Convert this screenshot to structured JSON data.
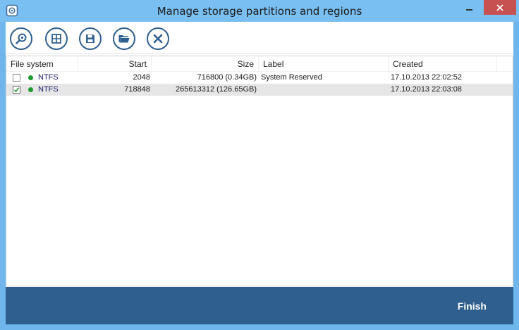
{
  "window": {
    "title": "Manage storage partitions and regions",
    "icon": "app-logo-icon",
    "controls": [
      "minimize-icon",
      "close-icon"
    ]
  },
  "toolbar": {
    "buttons": [
      {
        "icon": "search-icon"
      },
      {
        "icon": "regions-grid-icon"
      },
      {
        "icon": "save-icon"
      },
      {
        "icon": "open-folder-icon"
      },
      {
        "icon": "delete-icon"
      }
    ]
  },
  "list": {
    "columns": [
      "File system",
      "Start",
      "Size",
      "Label",
      "Created"
    ],
    "rows": [
      {
        "checked": false,
        "status_color": "#1e9a2e",
        "file_system": "NTFS",
        "start": "2048",
        "size": "716800 (0.34GB)",
        "label": "System Reserved",
        "created": "17.10.2013 22:02:52"
      },
      {
        "checked": true,
        "status_color": "#1e9a2e",
        "file_system": "NTFS",
        "start": "718848",
        "size": "265613312 (126.65GB)",
        "label": "",
        "created": "17.10.2013 22:03:08"
      }
    ]
  },
  "footer": {
    "finish_label": "Finish"
  },
  "colors": {
    "titlebar": "#79bff1",
    "footer": "#2e5f8e",
    "close_button": "#c75050",
    "status_ok": "#1e9a2e"
  }
}
